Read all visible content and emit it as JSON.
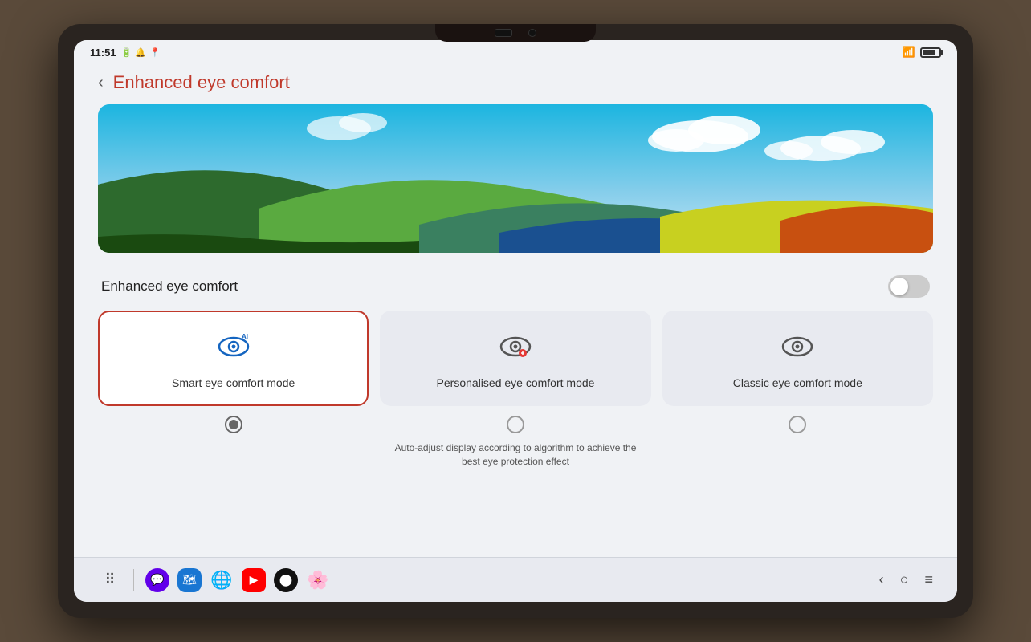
{
  "statusBar": {
    "time": "11:51",
    "wifiLabel": "WiFi",
    "batteryLevel": "80"
  },
  "header": {
    "backLabel": "‹",
    "title": "Enhanced eye comfort"
  },
  "toggleRow": {
    "label": "Enhanced eye comfort",
    "isOn": false
  },
  "modes": [
    {
      "id": "smart",
      "icon": "👁",
      "label": "Smart eye comfort mode",
      "isSelected": true,
      "radioSelected": true
    },
    {
      "id": "personalised",
      "icon": "👁",
      "label": "Personalised eye comfort mode",
      "isSelected": false,
      "radioSelected": false
    },
    {
      "id": "classic",
      "icon": "👁",
      "label": "Classic eye comfort mode",
      "isSelected": false,
      "radioSelected": false
    }
  ],
  "description": {
    "smart": "",
    "personalised": "Auto-adjust display according to algorithm to achieve the best eye protection effect",
    "classic": ""
  },
  "bottomNav": {
    "apps": [
      "⠿",
      "💬",
      "🗺",
      "🌐",
      "▶",
      "⬤",
      "🌸"
    ],
    "systemIcons": [
      "‹",
      "○",
      "≡"
    ]
  }
}
